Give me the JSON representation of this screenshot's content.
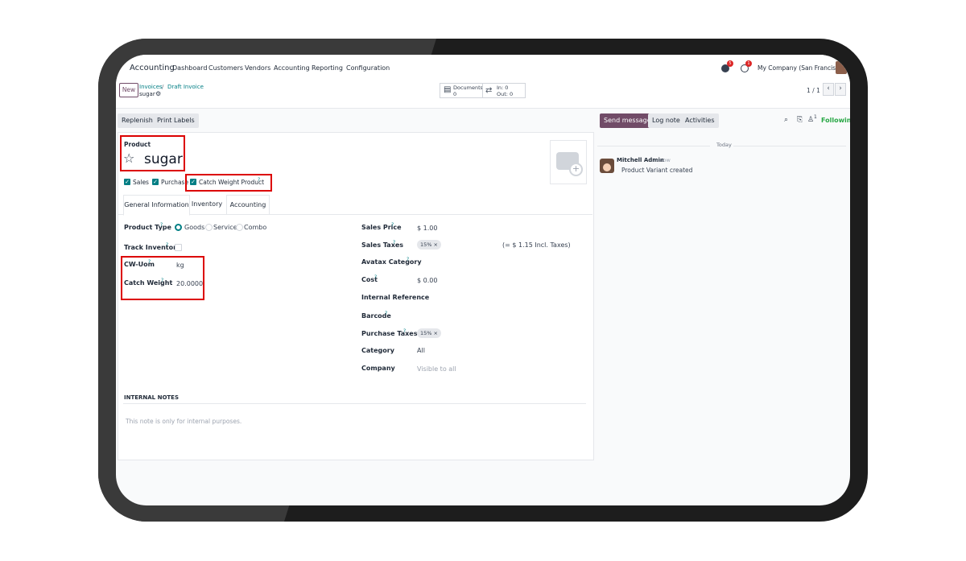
{
  "nav": {
    "app_name": "Accounting",
    "menu": [
      "Dashboard",
      "Customers",
      "Vendors",
      "Accounting",
      "Reporting",
      "Configuration"
    ],
    "messages_badge": "5",
    "activities_badge": "1",
    "company": "My Company (San Francisco)"
  },
  "control_panel": {
    "new_label": "New",
    "breadcrumb": [
      "Invoices",
      "Draft Invoice"
    ],
    "record_name": "sugar",
    "documents_label": "Documents",
    "documents_count": "0",
    "in_label": "In: 0",
    "out_label": "Out: 0",
    "pager": "1 / 1"
  },
  "actions": {
    "replenish": "Replenish",
    "print_labels": "Print Labels"
  },
  "product": {
    "section_label": "Product",
    "name": "sugar",
    "flags": {
      "sales": "Sales",
      "purchase": "Purchase",
      "catch_weight": "Catch Weight Product"
    },
    "tabs": [
      "General Information",
      "Inventory",
      "Accounting"
    ],
    "left_fields": {
      "product_type_label": "Product Type",
      "product_type_options": [
        "Goods",
        "Service",
        "Combo"
      ],
      "track_inventory_label": "Track Inventory",
      "cw_uom_label": "CW-Uom",
      "cw_uom_value": "kg",
      "catch_weight_label": "Catch Weight",
      "catch_weight_value": "20.0000"
    },
    "right_fields": {
      "sales_price_label": "Sales Price",
      "sales_price_value": "$ 1.00",
      "sales_taxes_label": "Sales Taxes",
      "sales_taxes_tag": "15% ×",
      "sales_taxes_incl": "(= $ 1.15 Incl. Taxes)",
      "avatax_category_label": "Avatax Category",
      "cost_label": "Cost",
      "cost_value": "$ 0.00",
      "internal_reference_label": "Internal Reference",
      "barcode_label": "Barcode",
      "purchase_taxes_label": "Purchase Taxes",
      "purchase_taxes_tag": "15% ×",
      "category_label": "Category",
      "category_value": "All",
      "company_label": "Company",
      "company_placeholder": "Visible to all"
    },
    "internal_notes_heading": "INTERNAL NOTES",
    "internal_notes_placeholder": "This note is only for internal purposes."
  },
  "chatter": {
    "send_message": "Send message",
    "log_note": "Log note",
    "activities": "Activities",
    "followers_count": "1",
    "following": "Following",
    "date_separator": "Today",
    "author": "Mitchell Admin",
    "time": "- now",
    "message": "Product Variant created"
  },
  "colors": {
    "brand": "#714b67",
    "accent": "#017e84",
    "highlight": "#dc0000",
    "following": "#28a745"
  }
}
